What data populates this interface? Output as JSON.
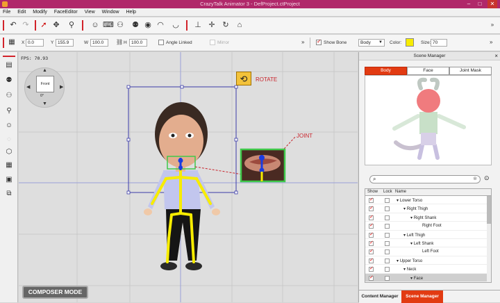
{
  "window": {
    "title": "CrazyTalk Animator 3 - DefProject.ctProject"
  },
  "menu": [
    "File",
    "Edit",
    "Modify",
    "FaceEditor",
    "View",
    "Window",
    "Help"
  ],
  "props": {
    "x_label": "X",
    "x_value": "0.0",
    "y_label": "Y",
    "y_value": "155.9",
    "w_label": "W",
    "w_value": "100.0",
    "h_label": "H",
    "h_value": "100.0",
    "angle_linked": "Angle Linked",
    "mirror": "Mirror",
    "show_bone": "Show Bone",
    "body_select": "Body",
    "color_label": "Color:",
    "color_value": "#f7ec00",
    "size_label": "Size:",
    "size_value": "70"
  },
  "viewport": {
    "fps": "FPS: 70.93",
    "nav_front": "Front",
    "nav_deg": "0°",
    "rotate_label": "ROTATE",
    "joint_label": "JOINT",
    "composer_mode": "COMPOSER MODE"
  },
  "scene": {
    "title": "Scene Manager",
    "tabs": [
      "Body",
      "Face",
      "Joint Mask"
    ],
    "cols": {
      "show": "Show",
      "lock": "Lock",
      "name": "Name"
    },
    "rows": [
      {
        "name": "Lower Torso",
        "indent": 0
      },
      {
        "name": "Right Thigh",
        "indent": 1
      },
      {
        "name": "Right Shank",
        "indent": 2
      },
      {
        "name": "Right Foot",
        "indent": 3
      },
      {
        "name": "Left Thigh",
        "indent": 1
      },
      {
        "name": "Left Shank",
        "indent": 2
      },
      {
        "name": "Left Foot",
        "indent": 3
      },
      {
        "name": "Upper Torso",
        "indent": 0
      },
      {
        "name": "Neck",
        "indent": 1
      },
      {
        "name": "Face",
        "indent": 2
      }
    ],
    "bottom_tabs": [
      "Content Manager",
      "Scene Manager"
    ]
  },
  "colors": {
    "title_bg": "#b0286a",
    "accent": "#e23b12",
    "bone": "#f7ec00",
    "joint": "#1a3ce0"
  }
}
